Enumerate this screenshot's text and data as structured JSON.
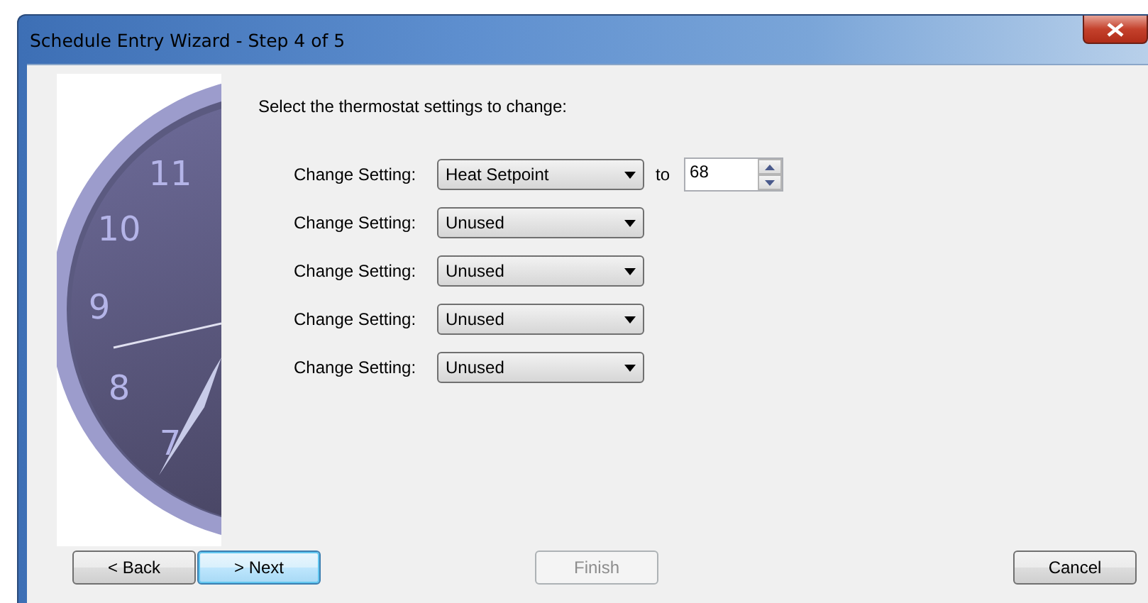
{
  "window": {
    "title": "Schedule Entry Wizard - Step 4 of 5"
  },
  "clock": {
    "numerals": [
      "11",
      "10",
      "9",
      "8",
      "7"
    ]
  },
  "heading": "Select the thermostat settings to change:",
  "settings": [
    {
      "kind": "with_value",
      "label": "Change Setting:",
      "value": "Heat Setpoint",
      "to_label": "to",
      "amount": "68"
    },
    {
      "kind": "plain",
      "label": "Change Setting:",
      "value": "Unused"
    },
    {
      "kind": "plain",
      "label": "Change Setting:",
      "value": "Unused"
    },
    {
      "kind": "plain",
      "label": "Change Setting:",
      "value": "Unused"
    },
    {
      "kind": "plain",
      "label": "Change Setting:",
      "value": "Unused"
    }
  ],
  "buttons": [
    {
      "label": "< Back",
      "disabled": false,
      "default": false,
      "kind": "back"
    },
    {
      "label": "> Next",
      "disabled": false,
      "default": true,
      "kind": "next"
    },
    {
      "label": "Finish",
      "disabled": true,
      "default": false,
      "kind": "finish"
    },
    {
      "label": "Cancel",
      "disabled": false,
      "default": false,
      "kind": "cancel"
    }
  ]
}
